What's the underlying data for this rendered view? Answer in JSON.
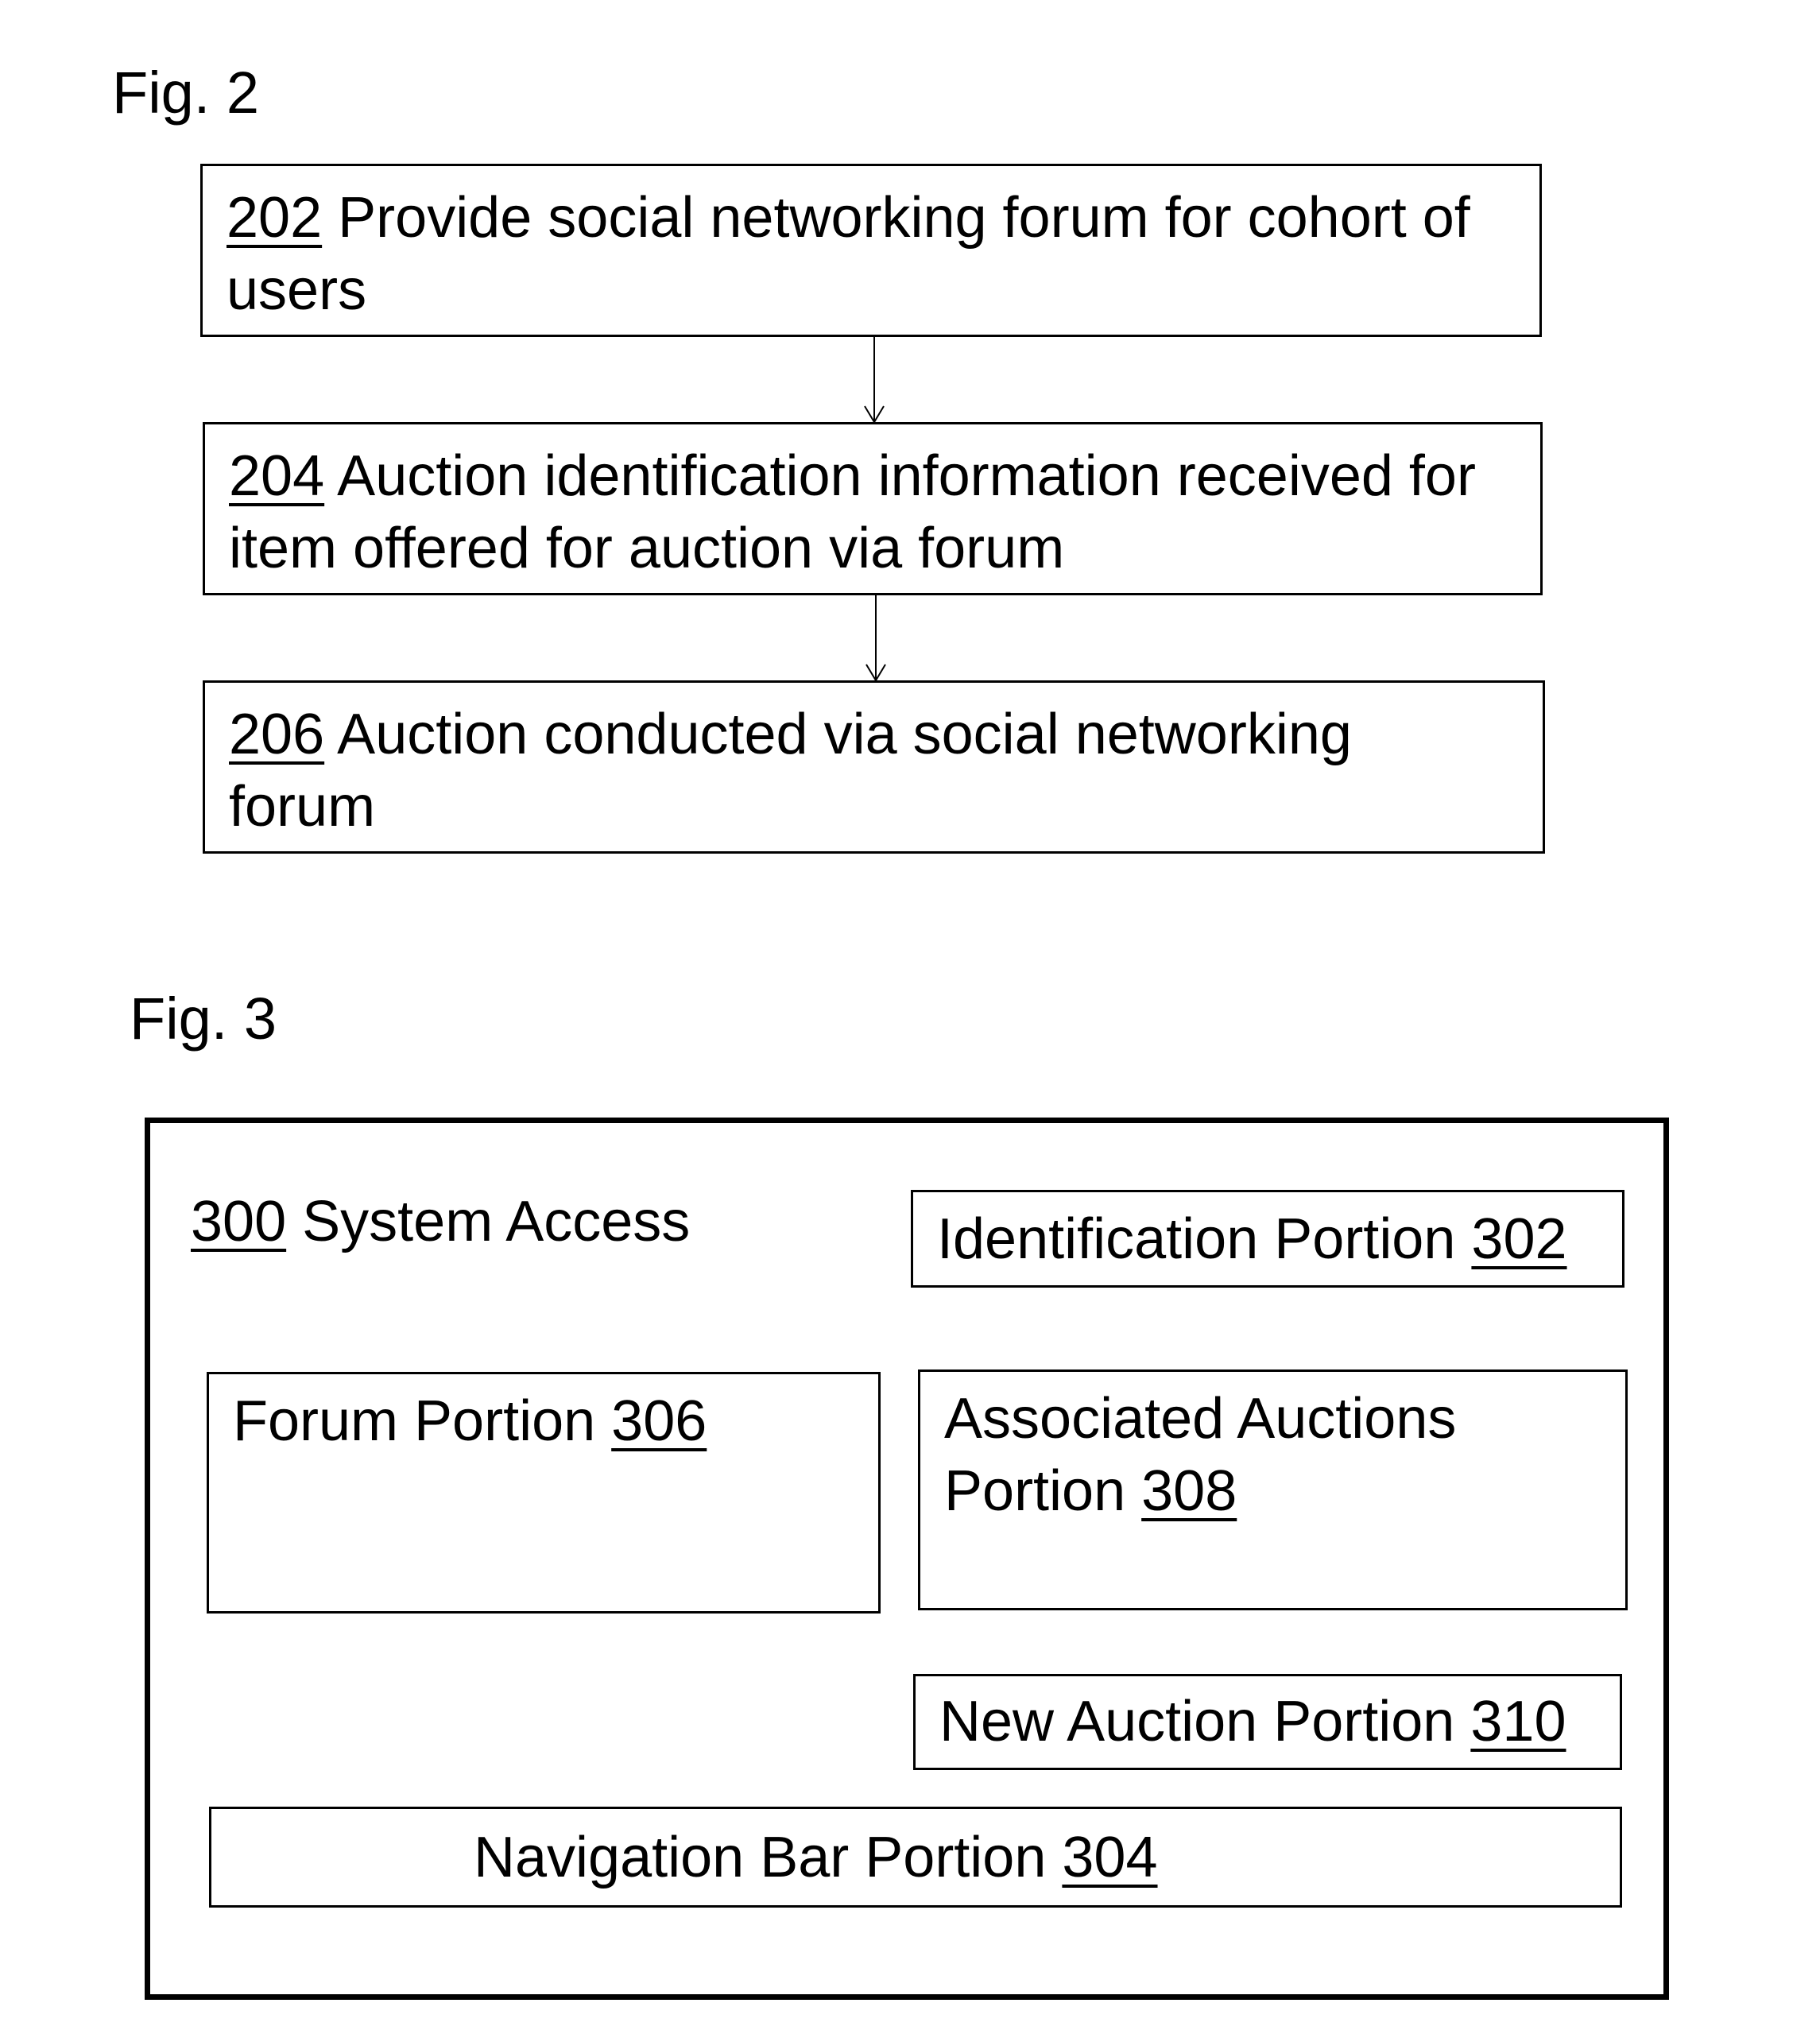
{
  "fig2": {
    "label": "Fig. 2",
    "steps": [
      {
        "ref": "202",
        "text": " Provide social networking forum for cohort of users"
      },
      {
        "ref": "204",
        "text": " Auction identification information received for item offered for auction via forum"
      },
      {
        "ref": "206",
        "text": " Auction conducted via social networking forum"
      }
    ]
  },
  "fig3": {
    "label": "Fig. 3",
    "system": {
      "ref": "300",
      "text": " System Access"
    },
    "identification": {
      "text": "Identification Portion ",
      "ref": "302"
    },
    "forum": {
      "text": "Forum Portion ",
      "ref": "306"
    },
    "associated": {
      "text": "Associated Auctions Portion ",
      "ref": "308"
    },
    "new_auction": {
      "text": "New Auction Portion ",
      "ref": "310"
    },
    "navigation": {
      "text": "Navigation Bar Portion ",
      "ref": "304"
    }
  }
}
